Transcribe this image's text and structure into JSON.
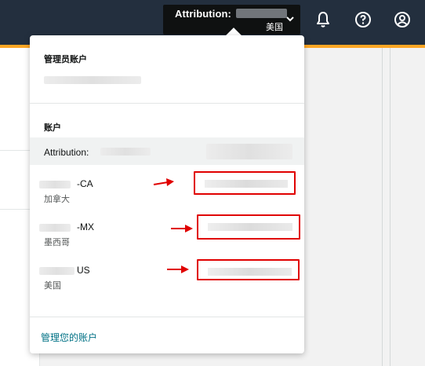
{
  "header": {
    "account_label": "Attribution:",
    "region": "美国",
    "icons": [
      "bell-icon",
      "help-icon",
      "user-icon"
    ]
  },
  "dropdown": {
    "admin_section_title": "管理员账户",
    "accounts_section_title": "账户",
    "selected_account_label": "Attribution:",
    "accounts": [
      {
        "name": "-CA",
        "region": "加拿大"
      },
      {
        "name": "-MX",
        "region": "墨西哥"
      },
      {
        "name": "US",
        "region": "美国"
      }
    ],
    "manage_link": "管理您的账户"
  },
  "colors": {
    "topbar": "#232f3e",
    "accent": "#ff9900",
    "highlight": "#e00000",
    "link": "#007185"
  }
}
